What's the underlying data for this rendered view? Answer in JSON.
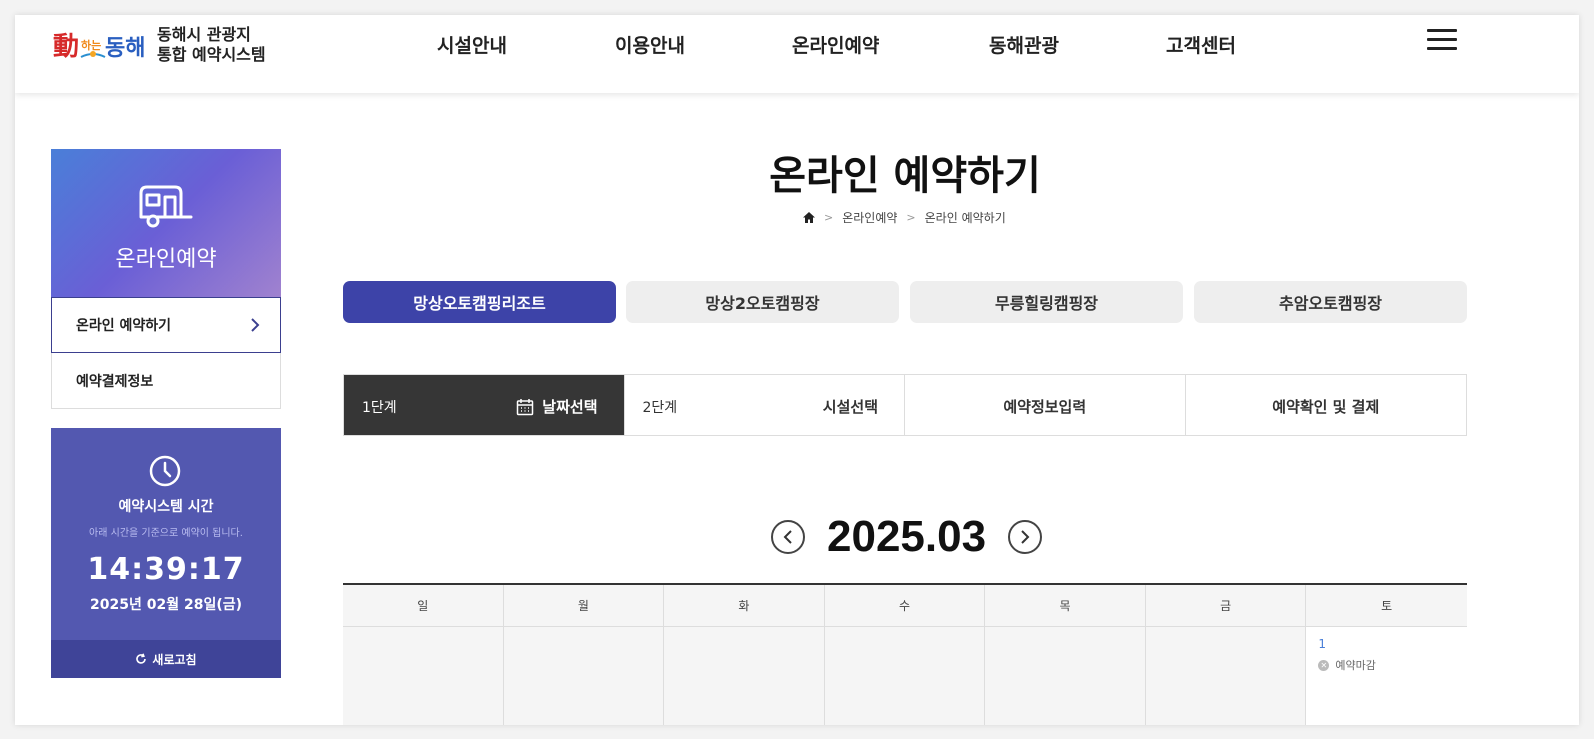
{
  "header": {
    "logo_line1": "동해시 관광지",
    "logo_line2": "통합 예약시스템",
    "nav": [
      "시설안내",
      "이용안내",
      "온라인예약",
      "동해관광",
      "고객센터"
    ]
  },
  "sidebar": {
    "section_title": "온라인예약",
    "items": [
      {
        "label": "온라인 예약하기",
        "active": true
      },
      {
        "label": "예약결제정보",
        "active": false
      }
    ],
    "clock": {
      "title": "예약시스템 시간",
      "subtitle": "아래 시간을 기준으로 예약이 됩니다.",
      "time": "14:39:17",
      "date": "2025년 02월 28일(금)",
      "refresh_label": "새로고침"
    }
  },
  "main": {
    "page_title": "온라인 예약하기",
    "breadcrumb": [
      "온라인예약",
      "온라인 예약하기"
    ],
    "tabs": [
      {
        "label": "망상오토캠핑리조트",
        "active": true
      },
      {
        "label": "망상2오토캠핑장",
        "active": false
      },
      {
        "label": "무릉힐링캠핑장",
        "active": false
      },
      {
        "label": "추암오토캠핑장",
        "active": false
      }
    ],
    "steps": [
      {
        "num": "1단계",
        "label": "날짜선택",
        "active": true
      },
      {
        "num": "2단계",
        "label": "시설선택",
        "active": false
      },
      {
        "num": "",
        "label": "예약정보입력",
        "active": false
      },
      {
        "num": "",
        "label": "예약확인 및 결제",
        "active": false
      }
    ],
    "calendar": {
      "month": "2025.03",
      "weekdays": [
        "일",
        "월",
        "화",
        "수",
        "목",
        "금",
        "토"
      ],
      "first_day_num": "1",
      "first_day_status": "예약마감"
    }
  },
  "colors": {
    "accent": "#3d43a8",
    "clock_bg": "#5358b0",
    "step_active": "#363636"
  }
}
